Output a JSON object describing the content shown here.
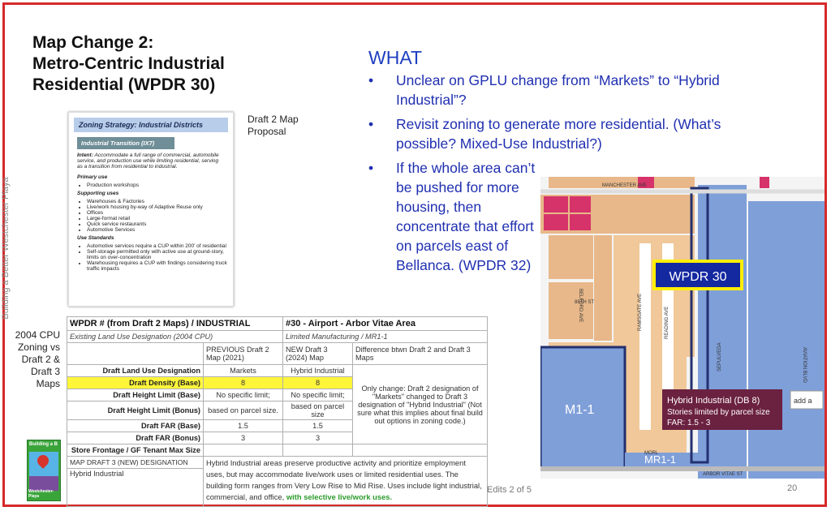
{
  "title": {
    "line1": "Map Change 2:",
    "line2": "Metro-Centric Industrial",
    "line3": "Residential (WPDR 30)"
  },
  "side_text": "Building a Better Westchester Playa",
  "what": {
    "heading": "WHAT",
    "bullets": [
      "Unclear on GPLU change from “Markets” to “Hybrid Industrial”?",
      "Revisit zoning to generate more residential. (What’s possible? Mixed-Use Industrial?)",
      "If the whole area can’t be pushed for more housing, then concentrate that effort on parcels east of Bellanca. (WPDR 32)"
    ]
  },
  "draft_label": {
    "l1": "Draft 2 Map",
    "l2": "Proposal"
  },
  "cpu_label": {
    "l1": "2004 CPU",
    "l2": "Zoning vs",
    "l3": "Draft 2 &",
    "l4": "Draft 3",
    "l5": "Maps"
  },
  "zoning_doc": {
    "header": "Zoning Strategy: Industrial Districts",
    "sub": "Industrial Transition (IX7)",
    "intent_label": "Intent:",
    "intent": "Accommodate a full range of commercial, automobile service, and production use while limiting residential, serving as a transition from residential to industrial.",
    "primary_label": "Primary use",
    "primary": [
      "Production workshops"
    ],
    "supporting_label": "Supporting uses",
    "supporting": [
      "Warehouses & Factories",
      "Live/work housing by-way of Adaptive Reuse only",
      "Offices",
      "Large-format retail",
      "Quick service restaurants",
      "Automotive Services"
    ],
    "standards_label": "Use Standards",
    "standards": [
      "Automotive services require a CUP within 200’ of residential",
      "Self-storage permitted only with active use at ground-story, limits on over-concentration",
      "Warehousing requires a CUP with findings considering truck traffic impacts"
    ]
  },
  "table": {
    "h_left": "WPDR # (from Draft 2 Maps) / INDUSTRIAL",
    "h_right": "#30 - Airport - Arbor Vitae Area",
    "existing_left": "Existing Land Use Designation (2004 CPU)",
    "existing_right": "Limited Manufacturing / MR1-1",
    "prev": "PREVIOUS Draft 2 Map (2021)",
    "new": "NEW Draft 3 (2024) Map",
    "diff_h": "Difference btwn Draft 2 and Draft 3 Maps",
    "rows": [
      {
        "label": "Draft Land Use Designation",
        "prev": "Markets",
        "new": "Hybrid Industrial"
      },
      {
        "label": "Draft Density (Base)",
        "prev": "8",
        "new": "8"
      },
      {
        "label": "Draft Height Limit (Base)",
        "prev": "No specific limit;",
        "new": "No specific limit;"
      },
      {
        "label": "Draft Height Limit (Bonus)",
        "prev": "based on parcel size.",
        "new": "based on parcel size"
      },
      {
        "label": "Draft FAR (Base)",
        "prev": "1.5",
        "new": "1.5"
      },
      {
        "label": "Draft FAR (Bonus)",
        "prev": "3",
        "new": "3"
      },
      {
        "label": "Store Frontage / GF Tenant Max Size",
        "prev": "",
        "new": ""
      }
    ],
    "diff_text": "Only change: Draft 2 designation of \"Markets\" changed to Draft 3 designation of \"Hybrid Industrial\" (Not sure what this implies about final build out options in zoning code.)",
    "d3_label": "MAP DRAFT 3 (NEW) DESIGNATION",
    "d3_value": "Hybrid Industrial",
    "d3_desc": "Hybrid Industrial areas preserve productive activity and prioritize employment uses, but may accommodate live/work uses or limited residential uses. The building form ranges from Very Low Rise to Mid Rise. Uses include light industrial, commercial, and office,",
    "d3_desc_green": "with selective live/work uses."
  },
  "map": {
    "manchester": "MANCHESTER AVE",
    "arbor": "ARBOR VITAE ST",
    "belford": "BELFORD AVE",
    "ramsgate": "RAMSGATE AVE",
    "reading": "READING AVE",
    "st88": "88TH ST",
    "aviation": "AVIATION BLVD",
    "sep": "SEPULVEDA",
    "morl": "MORL",
    "wpdr": "WPDR 30",
    "m11": "M1-1",
    "mr11": "MR1-1",
    "hybrid_title": "Hybrid Industrial (DB 8)",
    "hybrid_l2": "Stories limited by parcel size",
    "hybrid_l3": "FAR: 1.5 - 3",
    "add": "add a"
  },
  "footer": {
    "edits": "Edits 2 of 5",
    "page": "20"
  },
  "logo": {
    "top": "Building a B",
    "bottom": "Westchester-Playa"
  }
}
